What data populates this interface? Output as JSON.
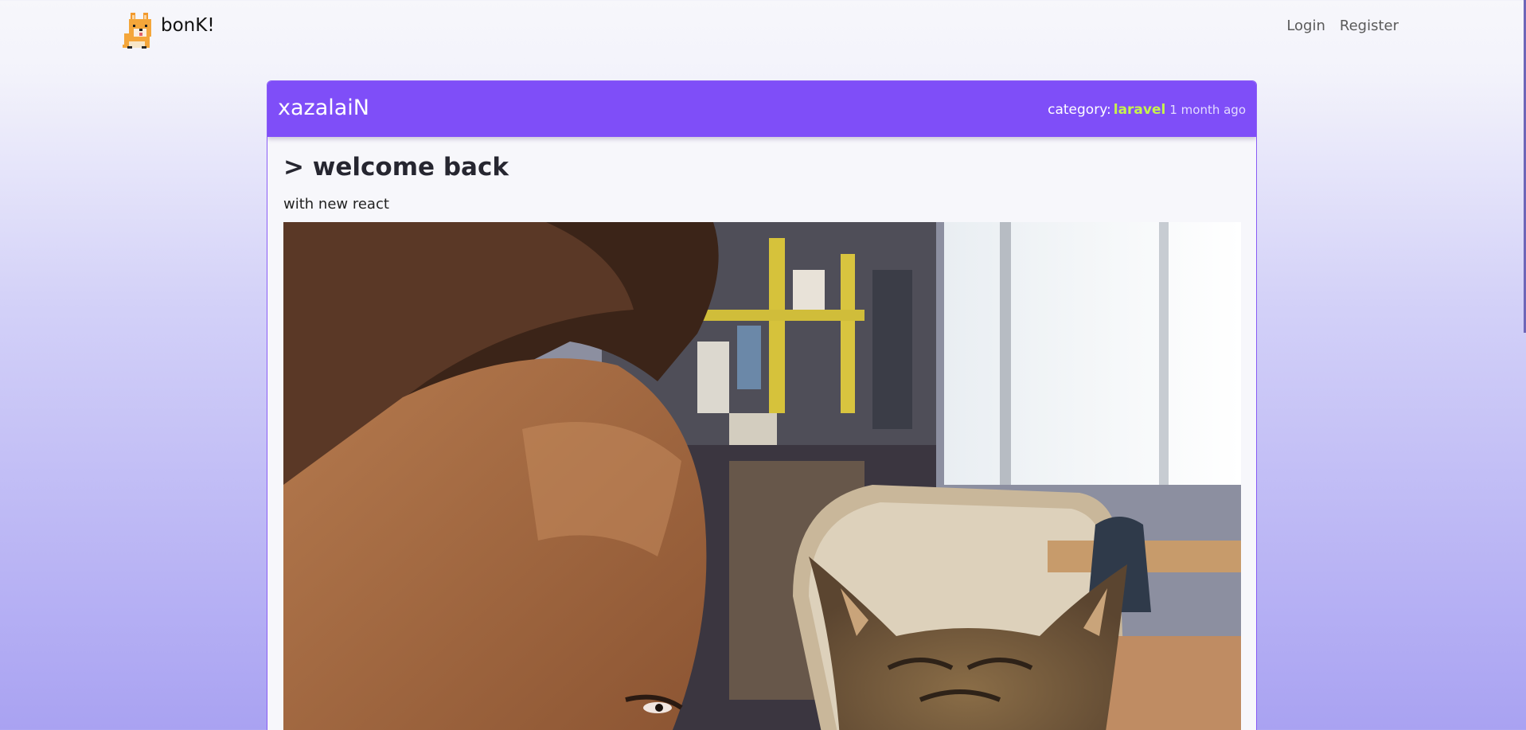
{
  "navbar": {
    "brand": "bonK!",
    "links": [
      "Login",
      "Register"
    ]
  },
  "post": {
    "author": "xazalaiN",
    "category_label": "category:",
    "category": "laravel",
    "time": "1 month ago",
    "title": "> welcome back",
    "text": "with new react"
  },
  "icons": {
    "brand": "shiba-dog-logo-icon"
  },
  "colors": {
    "accent": "#7f4ef8",
    "category": "#c6f24e"
  }
}
